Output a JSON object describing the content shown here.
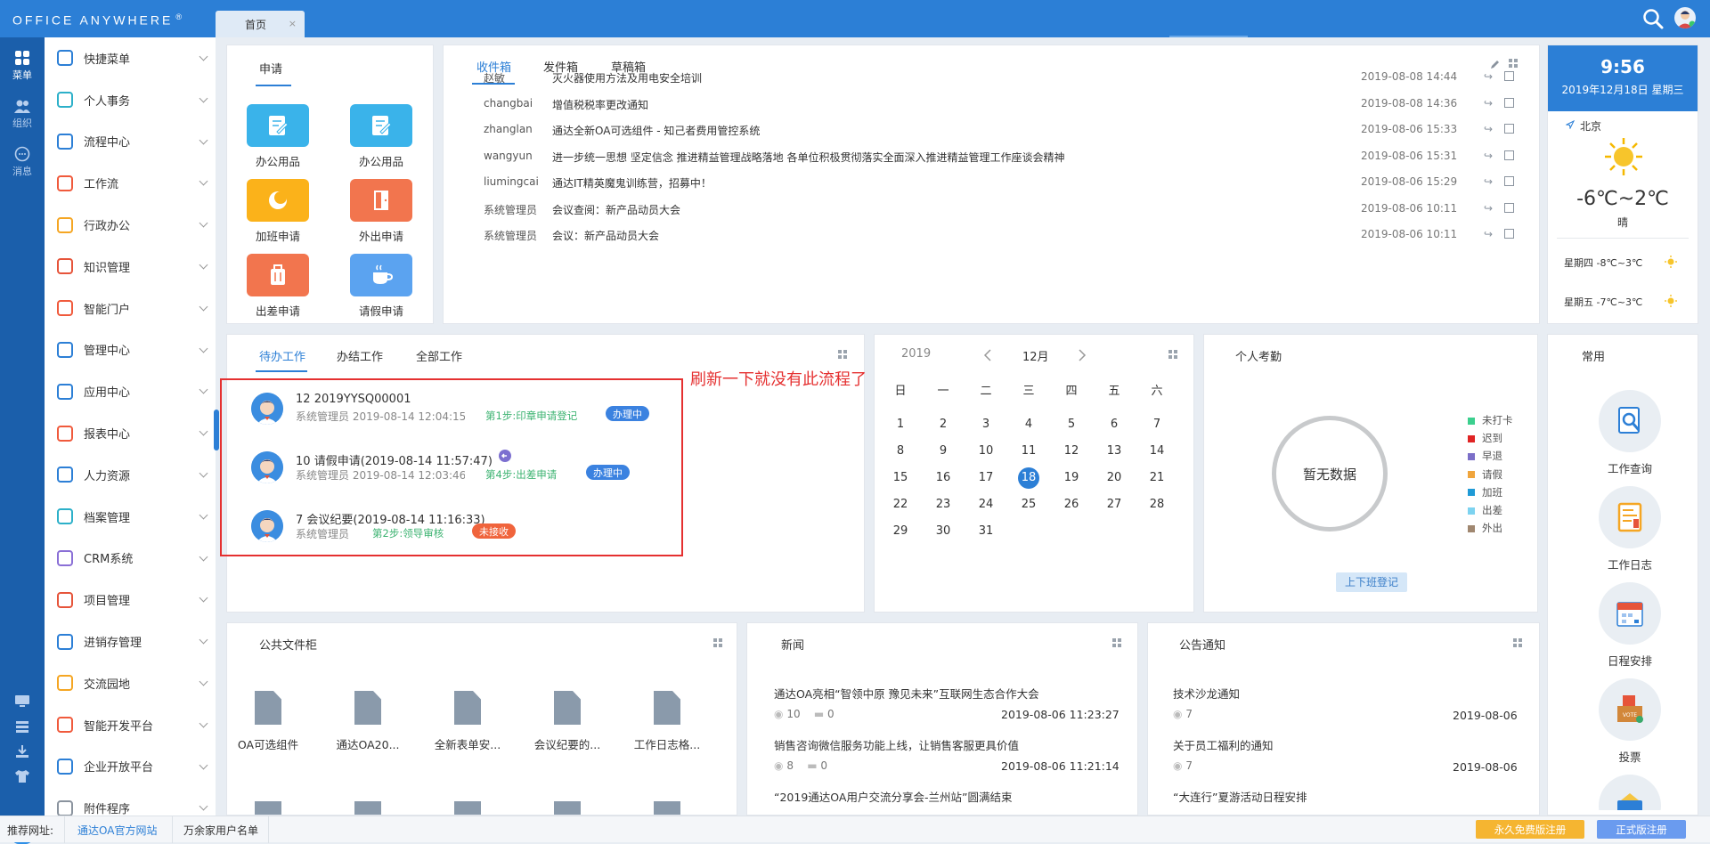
{
  "app": {
    "logo": "Office Anywhere",
    "logo_mark": "®"
  },
  "tabs": [
    {
      "label": "首页",
      "close": "×"
    }
  ],
  "rail": [
    {
      "label": "菜单"
    },
    {
      "label": "组织"
    },
    {
      "label": "消息"
    }
  ],
  "sidebar": {
    "items": [
      {
        "label": "快捷菜单",
        "icon": "grid-menu-icon"
      },
      {
        "label": "个人事务",
        "icon": "person-icon"
      },
      {
        "label": "流程中心",
        "icon": "flow-icon"
      },
      {
        "label": "工作流",
        "icon": "workflow-icon"
      },
      {
        "label": "行政办公",
        "icon": "briefcase-icon"
      },
      {
        "label": "知识管理",
        "icon": "book-icon"
      },
      {
        "label": "智能门户",
        "icon": "portal-icon"
      },
      {
        "label": "管理中心",
        "icon": "dashboard-icon"
      },
      {
        "label": "应用中心",
        "icon": "app-icon"
      },
      {
        "label": "报表中心",
        "icon": "bar-chart-icon"
      },
      {
        "label": "人力资源",
        "icon": "people-icon"
      },
      {
        "label": "档案管理",
        "icon": "archive-icon"
      },
      {
        "label": "CRM系统",
        "icon": "crm-icon"
      },
      {
        "label": "项目管理",
        "icon": "project-icon"
      },
      {
        "label": "进销存管理",
        "icon": "tag-icon"
      },
      {
        "label": "交流园地",
        "icon": "cup-icon"
      },
      {
        "label": "智能开发平台",
        "icon": "dev-icon"
      },
      {
        "label": "企业开放平台",
        "icon": "cube-icon"
      },
      {
        "label": "附件程序",
        "icon": "clip-icon"
      }
    ]
  },
  "apply": {
    "title": "申请",
    "apps": [
      {
        "label": "办公用品",
        "color": "#3ab3ea"
      },
      {
        "label": "办公用品",
        "color": "#3ab3ea"
      },
      {
        "label": "加班申请",
        "color": "#fbb21a"
      },
      {
        "label": "外出申请",
        "color": "#f2754e"
      },
      {
        "label": "出差申请",
        "color": "#f2754e"
      },
      {
        "label": "请假申请",
        "color": "#5ba3f0"
      }
    ]
  },
  "mail": {
    "tabs": [
      "收件箱",
      "发件箱",
      "草稿箱"
    ],
    "rows": [
      {
        "from": "赵敏",
        "subject": "灭火器使用方法及用电安全培训",
        "date": "2019-08-08 14:44"
      },
      {
        "from": "changbai",
        "subject": "增值税税率更改通知",
        "date": "2019-08-08 14:36"
      },
      {
        "from": "zhanglan",
        "subject": "通达全新OA可选组件 - 知己者费用管控系统",
        "date": "2019-08-06 15:33"
      },
      {
        "from": "wangyun",
        "subject": "进一步统一思想 坚定信念 推进精益管理战略落地 各单位积极贯彻落实全面深入推进精益管理工作座谈会精神",
        "date": "2019-08-06 15:31"
      },
      {
        "from": "liumingcai",
        "subject": "通达IT精英魔鬼训练营，招募中！",
        "date": "2019-08-06 15:29"
      },
      {
        "from": "系统管理员",
        "subject": "会议查阅：新产品动员大会",
        "date": "2019-08-06 10:11"
      },
      {
        "from": "系统管理员",
        "subject": "会议：新产品动员大会",
        "date": "2019-08-06 10:11"
      }
    ]
  },
  "weather": {
    "time": "9:56",
    "date": "2019年12月18日 星期三",
    "city": "北京",
    "temp": "-6℃~2℃",
    "cond": "晴",
    "forecast": [
      {
        "day": "星期四",
        "temp": "-8℃~3℃"
      },
      {
        "day": "星期五",
        "temp": "-7℃~3℃"
      }
    ]
  },
  "work": {
    "tabs": [
      "待办工作",
      "办结工作",
      "全部工作"
    ],
    "rows": [
      {
        "id": "12",
        "title": "2019YYSQ00001",
        "user": "系统管理员",
        "time": "2019-08-14 12:04:15",
        "step": "第1步:印章申请登记",
        "status": "办理中",
        "status_color": "#3b82e0"
      },
      {
        "id": "10",
        "title": "请假申请(2019-08-14 11:57:47)",
        "user": "系统管理员",
        "time": "2019-08-14 12:03:46",
        "step": "第4步:出差申请",
        "status": "办理中",
        "status_color": "#3b82e0"
      },
      {
        "id": "7",
        "title": "会议纪要(2019-08-14 11:16:33)",
        "user": "系统管理员",
        "time": "",
        "step": "第2步:领导审核",
        "status": "未接收",
        "status_color": "#f0643c"
      }
    ]
  },
  "annotation": "刷新一下就没有此流程了",
  "calendar": {
    "year": "2019",
    "month": "12月",
    "weekdays": [
      "日",
      "一",
      "二",
      "三",
      "四",
      "五",
      "六"
    ],
    "today": 18,
    "days": [
      [
        "1",
        "2",
        "3",
        "4",
        "5",
        "6",
        "7"
      ],
      [
        "8",
        "9",
        "10",
        "11",
        "12",
        "13",
        "14"
      ],
      [
        "15",
        "16",
        "17",
        "18",
        "19",
        "20",
        "21"
      ],
      [
        "22",
        "23",
        "24",
        "25",
        "26",
        "27",
        "28"
      ],
      [
        "29",
        "30",
        "31",
        "",
        "",
        "",
        ""
      ]
    ]
  },
  "attendance": {
    "title": "个人考勤",
    "empty": "暂无数据",
    "button": "上下班登记",
    "legend": [
      {
        "label": "未打卡",
        "color": "#3ccf8e"
      },
      {
        "label": "迟到",
        "color": "#e02424"
      },
      {
        "label": "早退",
        "color": "#7b6fc8"
      },
      {
        "label": "请假",
        "color": "#f0a53c"
      },
      {
        "label": "加班",
        "color": "#1f9ad6"
      },
      {
        "label": "出差",
        "color": "#7dd3f0"
      },
      {
        "label": "外出",
        "color": "#a08770"
      }
    ]
  },
  "quick": {
    "title": "常用",
    "items": [
      {
        "label": "工作查询"
      },
      {
        "label": "工作日志"
      },
      {
        "label": "日程安排"
      },
      {
        "label": "投票",
        "badge": "VOTE"
      },
      {
        "label": ""
      }
    ]
  },
  "files": {
    "title": "公共文件柜",
    "items": [
      "OA可选组件",
      "通达OA20...",
      "全新表单安...",
      "会议纪要的...",
      "工作日志格..."
    ]
  },
  "news": {
    "title": "新闻",
    "items": [
      {
        "title": "通达OA亮相“智领中原 豫见未来”互联网生态合作大会",
        "views": "10",
        "comments": "0",
        "date": "2019-08-06 11:23:27"
      },
      {
        "title": "销售咨询微信服务功能上线，让销售客服更具价值",
        "views": "8",
        "comments": "0",
        "date": "2019-08-06 11:21:14"
      },
      {
        "title": "“2019通达OA用户交流分享会-兰州站”圆满结束",
        "views": "",
        "comments": "",
        "date": ""
      }
    ]
  },
  "notice": {
    "title": "公告通知",
    "items": [
      {
        "title": "技术沙龙通知",
        "views": "7",
        "date": "2019-08-06"
      },
      {
        "title": "关于员工福利的通知",
        "views": "7",
        "date": "2019-08-06"
      },
      {
        "title": "“大连行”夏游活动日程安排",
        "views": "",
        "date": ""
      }
    ]
  },
  "footer": {
    "label": "推荐网址:",
    "links": [
      "通达OA官方网站",
      "万余家用户名单"
    ],
    "buttons": [
      {
        "label": "永久免费版注册",
        "color": "#f5b531"
      },
      {
        "label": "正式版注册",
        "color": "#6a9bef"
      }
    ]
  }
}
